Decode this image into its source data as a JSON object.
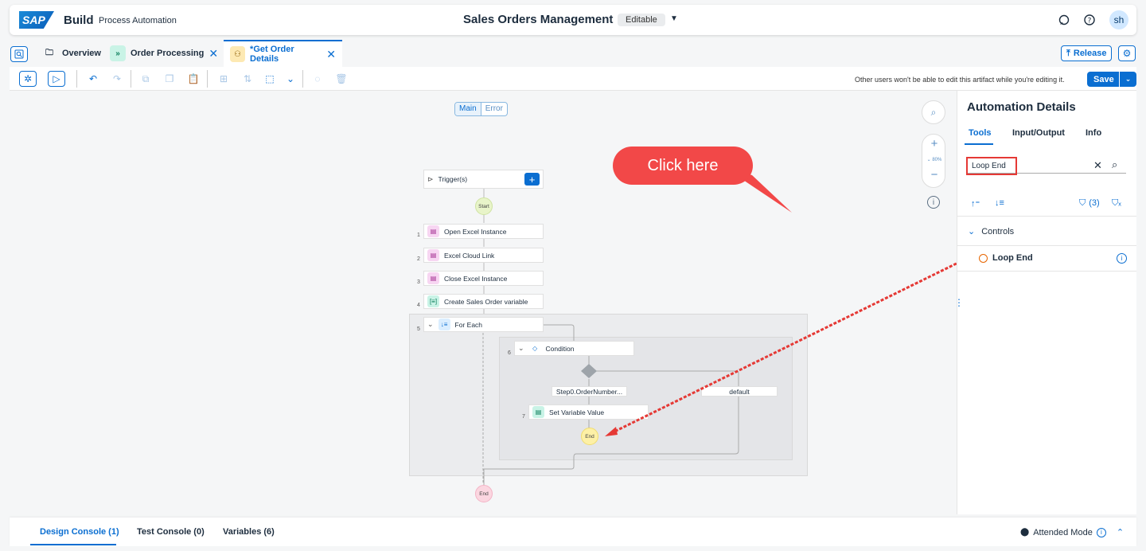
{
  "shell": {
    "logo": "SAP",
    "product": "Build",
    "subproduct": "Process Automation",
    "project_title": "Sales Orders Management",
    "status_badge": "Editable",
    "avatar_initials": "sh"
  },
  "tabs": [
    {
      "label": "Overview",
      "closable": false
    },
    {
      "label": "Order Processing",
      "closable": true
    },
    {
      "label": "*Get Order Details",
      "closable": true,
      "active": true
    }
  ],
  "header_actions": {
    "release": "Release"
  },
  "toolbar": {
    "edit_note": "Other users won't be able to edit this artifact while you're editing it.",
    "save": "Save"
  },
  "canvas": {
    "segments": [
      "Main",
      "Error"
    ],
    "zoom_level": "80%",
    "trigger_label": "Trigger(s)",
    "start_label": "Start",
    "end_label": "End",
    "steps": [
      {
        "num": "1",
        "label": "Open Excel Instance"
      },
      {
        "num": "2",
        "label": "Excel Cloud Link"
      },
      {
        "num": "3",
        "label": "Close Excel Instance"
      },
      {
        "num": "4",
        "label": "Create Sales Order variable"
      },
      {
        "num": "5",
        "label": "For Each"
      },
      {
        "num": "6",
        "label": "Condition"
      },
      {
        "num": "7",
        "label": "Set Variable Value"
      }
    ],
    "branch_left": "Step0.OrderNumber...",
    "branch_right": "default",
    "inner_end": "End",
    "callout": "Click here"
  },
  "panel": {
    "title": "Automation Details",
    "tabs": [
      "Tools",
      "Input/Output",
      "Info"
    ],
    "search_value": "Loop End",
    "filter_count": "(3)",
    "group": "Controls",
    "result": "Loop End"
  },
  "bottom": {
    "tabs": [
      "Design Console (1)",
      "Test Console (0)",
      "Variables (6)"
    ],
    "attended": "Attended Mode"
  }
}
